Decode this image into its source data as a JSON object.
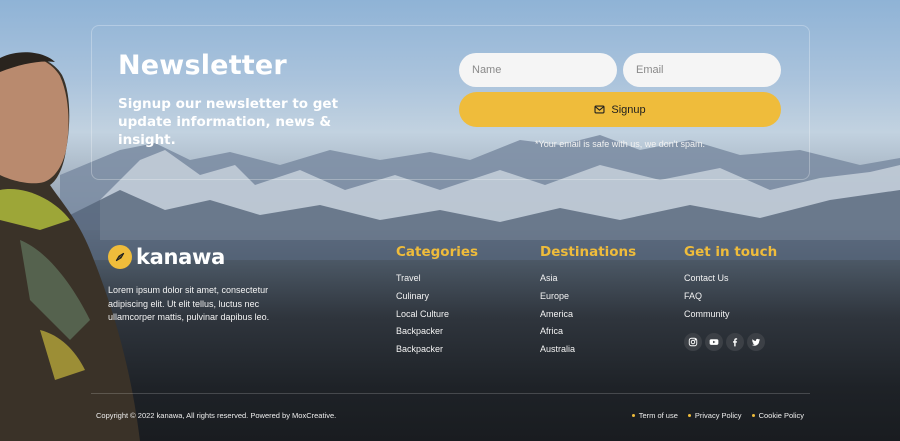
{
  "newsletter": {
    "title": "Newsletter",
    "subtitle": "Signup our newsletter to get update information, news & insight.",
    "name_placeholder": "Name",
    "email_placeholder": "Email",
    "signup_label": "Signup",
    "spam_note": "*Your email is safe with us, we don't spam."
  },
  "brand": {
    "name": "kanawa",
    "about": "Lorem ipsum dolor sit amet, consectetur adipiscing elit. Ut elit tellus, luctus nec ullamcorper mattis, pulvinar dapibus leo."
  },
  "columns": [
    {
      "heading": "Categories",
      "links": [
        "Travel",
        "Culinary",
        "Local Culture",
        "Backpacker",
        "Backpacker"
      ]
    },
    {
      "heading": "Destinations",
      "links": [
        "Asia",
        "Europe",
        "America",
        "Africa",
        "Australia"
      ]
    },
    {
      "heading": "Get in touch",
      "links": [
        "Contact Us",
        "FAQ",
        "Community"
      ]
    }
  ],
  "socials": [
    "instagram-icon",
    "youtube-icon",
    "facebook-icon",
    "twitter-icon"
  ],
  "footer": {
    "copyright": "Copyright © 2022 kanawa, All rights reserved. Powered by MoxCreative.",
    "legal": [
      "Term of use",
      "Privacy Policy",
      "Cookie Policy"
    ]
  },
  "colors": {
    "accent": "#efbc3b",
    "social_bg": "#3c4046"
  }
}
